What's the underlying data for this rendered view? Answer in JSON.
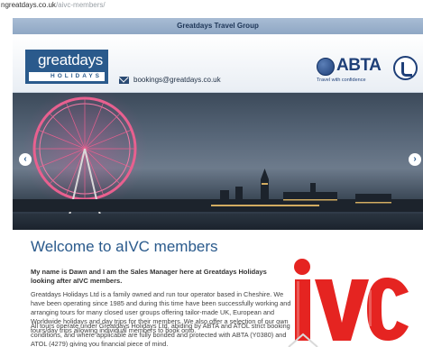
{
  "address_bar": {
    "host": "ngreatdays.co.uk",
    "path": "/aivc-members/"
  },
  "group_bar": {
    "title": "Greatdays Travel Group"
  },
  "header": {
    "logo_main": "greatdays",
    "logo_sub": "HOLIDAYS",
    "email": "bookings@greatdays.co.uk",
    "abta_text": "ABTA",
    "abta_tagline": "Travel with confidence"
  },
  "slider": {
    "prev_icon": "chevron-left-icon",
    "next_icon": "chevron-right-icon",
    "prev_glyph": "‹",
    "next_glyph": "›"
  },
  "main": {
    "heading": "Welcome to aIVC members",
    "intro": "My name is Dawn and I am the Sales Manager here at Greatdays Holidays looking after aIVC members.",
    "para1": "Greatdays Holidays Ltd is a family owned and run tour operator based in Cheshire. We have been operating since 1985 and during this time have been successfully working and arranging tours for many closed user groups offering tailor-made UK, European and Worldwide holidays and day trips for their members. We also offer a selection of our own tours/day trips allowing individual members to book onto.",
    "para2": "All tours operate under Greatdays Holidays Ltd, abiding by ABTA and ATOL strict booking conditions, and where applicable are fully bonded and protected with ABTA (Y0380) and ATOL (4279) giving you financial piece of mind.",
    "ivc_logo_text": "iVc"
  },
  "colors": {
    "brand_blue": "#2a5a8c",
    "ivc_red": "#e52421",
    "group_bar": "#a8bcd4"
  }
}
